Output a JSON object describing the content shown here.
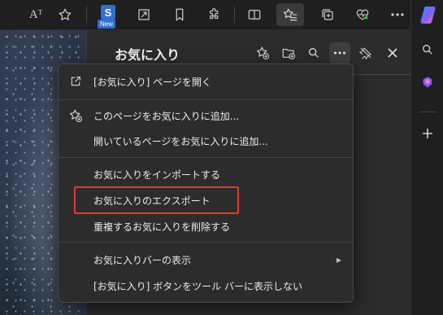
{
  "colors": {
    "menu_bg": "#2c2c2c",
    "highlight": "#e23a2e",
    "accent": "#2f6fd1"
  },
  "toolbar": {
    "read_aloud_label": "Aᵀ",
    "new_badge": "New",
    "logo_letter": "S"
  },
  "panel": {
    "title": "お気に入り"
  },
  "menu": {
    "items": [
      {
        "label": "[お気に入り] ページを開く",
        "icon": "open-external-icon"
      },
      {
        "label": "このページをお気に入りに追加...",
        "icon": "star-add-icon"
      },
      {
        "label": "開いているページをお気に入りに追加...",
        "icon": ""
      },
      {
        "label": "お気に入りをインポートする",
        "icon": ""
      },
      {
        "label": "お気に入りのエクスポート",
        "icon": ""
      },
      {
        "label": "重複するお気に入りを削除する",
        "icon": ""
      },
      {
        "label": "お気に入りバーの表示",
        "icon": "",
        "submenu": true
      },
      {
        "label": "[お気に入り] ボタンをツール バーに表示しない",
        "icon": ""
      }
    ],
    "submenu_arrow": "▶"
  }
}
